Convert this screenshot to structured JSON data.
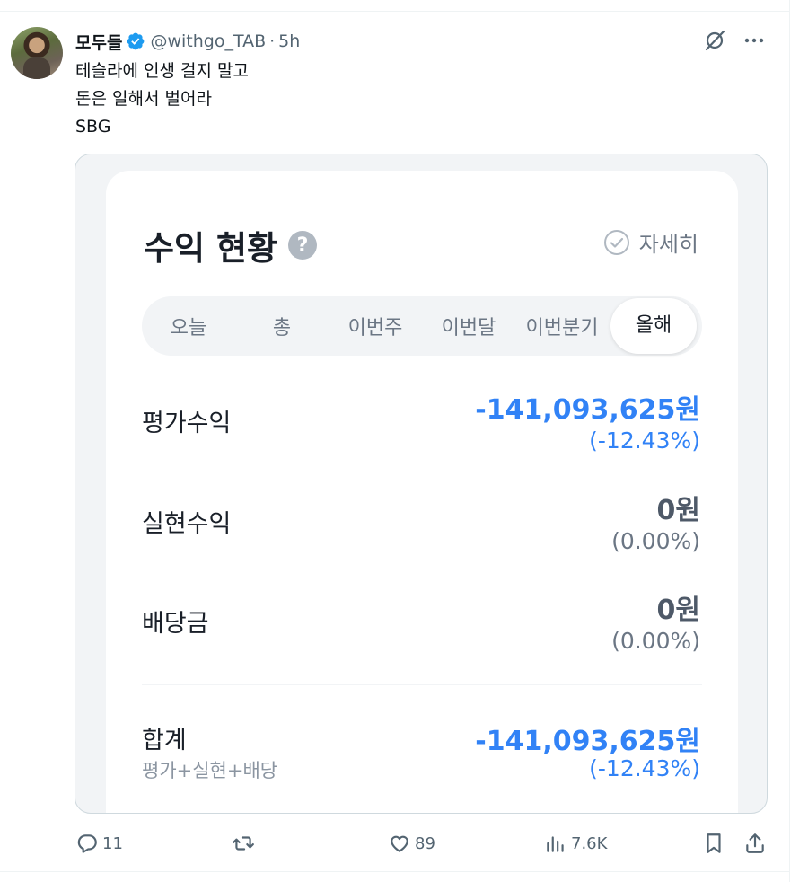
{
  "tweet": {
    "author_name": "모두들",
    "handle": "@withgo_TAB",
    "separator": "·",
    "time": "5h",
    "lines": [
      "테슬라에 인생 걸지 말고",
      "돈은 일해서 벌어라",
      "SBG"
    ]
  },
  "card": {
    "title": "수익 현황",
    "help_icon": "?",
    "detail_label": "자세히",
    "tabs": [
      "오늘",
      "총",
      "이번주",
      "이번달",
      "이번분기",
      "올해"
    ],
    "active_tab": "올해",
    "rows": [
      {
        "label": "평가수익",
        "value": "-141,093,625원",
        "pct": "(-12.43%)"
      },
      {
        "label": "실현수익",
        "value": "0원",
        "pct": "(0.00%)"
      },
      {
        "label": "배당금",
        "value": "0원",
        "pct": "(0.00%)"
      }
    ],
    "total": {
      "label": "합계",
      "sublabel": "평가+실현+배당",
      "value": "-141,093,625원",
      "pct": "(-12.43%)"
    }
  },
  "actions": {
    "reply_count": "11",
    "retweet_count": "",
    "like_count": "89",
    "views_count": "7.6K"
  },
  "colors": {
    "negative": "#3182f6",
    "verified": "#1d9bf0",
    "muted": "#536471"
  },
  "icons": [
    "verified-badge-icon",
    "grok-slash-icon",
    "more-icon",
    "help-icon",
    "check-circle-icon",
    "reply-icon",
    "retweet-icon",
    "like-icon",
    "views-icon",
    "bookmark-icon",
    "share-icon"
  ]
}
